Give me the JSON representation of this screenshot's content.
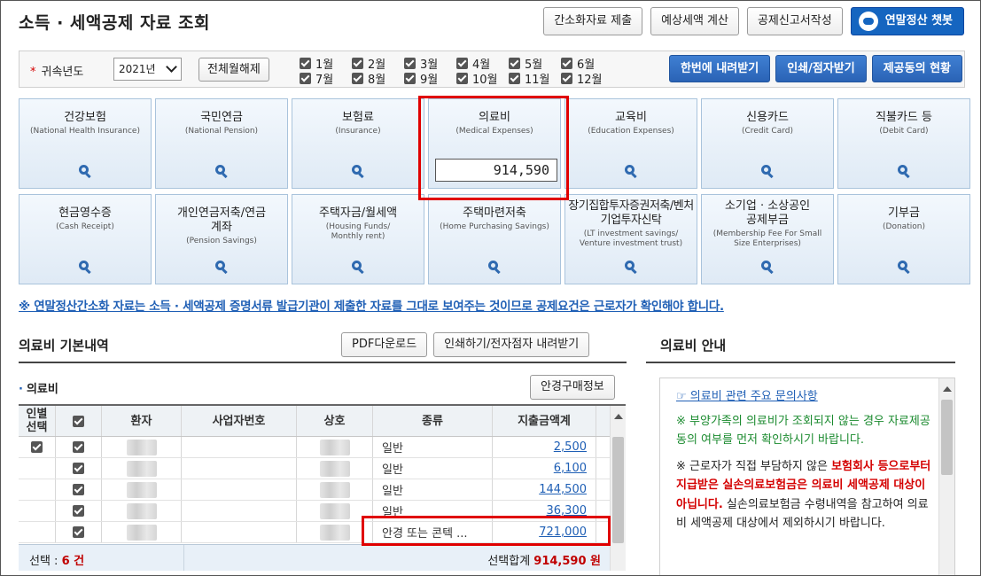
{
  "header": {
    "title": "소득 · 세액공제 자료 조회",
    "buttons": [
      "간소화자료 제출",
      "예상세액 계산",
      "공제신고서작성"
    ],
    "chatbot_label": "연말정산 챗봇"
  },
  "yearbar": {
    "label": "귀속년도",
    "year": "2021년",
    "toggle_all": "전체월해제",
    "months": [
      "1월",
      "2월",
      "3월",
      "4월",
      "5월",
      "6월",
      "7월",
      "8월",
      "9월",
      "10월",
      "11월",
      "12월"
    ],
    "actions": [
      "한번에 내려받기",
      "인쇄/점자받기",
      "제공동의 현황"
    ]
  },
  "tiles": [
    {
      "kr": "건강보험",
      "en": "(National Health Insurance)"
    },
    {
      "kr": "국민연금",
      "en": "(National Pension)"
    },
    {
      "kr": "보험료",
      "en": "(Insurance)"
    },
    {
      "kr": "의료비",
      "en": "(Medical Expenses)",
      "amount": "914,590"
    },
    {
      "kr": "교육비",
      "en": "(Education Expenses)"
    },
    {
      "kr": "신용카드",
      "en": "(Credit Card)"
    },
    {
      "kr": "직불카드 등",
      "en": "(Debit Card)"
    },
    {
      "kr": "현금영수증",
      "en": "(Cash Receipt)"
    },
    {
      "kr": "개인연금저축/연금계좌",
      "en": "(Pension Savings)"
    },
    {
      "kr": "주택자금/월세액",
      "en": "(Housing Funds/ Monthly rent)"
    },
    {
      "kr": "주택마련저축",
      "en": "(Home Purchasing Savings)"
    },
    {
      "kr": "장기집합투자증권저축/벤처기업투자신탁",
      "en": "(LT investment savings/ Venture investment trust)"
    },
    {
      "kr": "소기업 · 소상공인 공제부금",
      "en": "(Membership Fee For Small Size Enterprises)"
    },
    {
      "kr": "기부금",
      "en": "(Donation)"
    }
  ],
  "notice": "※ 연말정산간소화 자료는 소득 · 세액공제 증명서류 발급기관이 제출한 자료를 그대로 보여주는 것이므로 공제요건은 근로자가 확인해야 합니다.",
  "left": {
    "section_title": "의료비 기본내역",
    "pdf_button": "PDF다운로드",
    "print_button": "인쇄하기/전자점자 내려받기",
    "sub_title": "의료비",
    "glasses_button": "안경구매정보",
    "columns": [
      "인별선택",
      "",
      "환자",
      "사업자번호",
      "상호",
      "종류",
      "지출금액계"
    ],
    "rows": [
      {
        "type": "일반",
        "amount": "2,500"
      },
      {
        "type": "일반",
        "amount": "6,100"
      },
      {
        "type": "일반",
        "amount": "144,500"
      },
      {
        "type": "일반",
        "amount": "36,300"
      },
      {
        "type": "안경 또는 콘텍 ...",
        "amount": "721,000"
      }
    ],
    "footer_label": "선택 :",
    "footer_count": "6 건",
    "footer_sum_label": "선택합계",
    "footer_sum": "914,590 원"
  },
  "right": {
    "title": "의료비 안내",
    "link": "☞ 의료비 관련 주요 문의사항",
    "note1": "※ 부양가족의 의료비가 조회되지 않는 경우 자료제공동의 여부를 먼저 확인하시기 바랍니다.",
    "note2_pre": "※ 근로자가 직접 부담하지 않은 ",
    "note2_bold": "보험회사 등으로부터 지급받은 실손의료보험금은 의료비 세액공제 대상이 아닙니다.",
    "note2_post": " 실손의료보험금 수령내역을 참고하여 의료비 세액공제 대상에서 제외하시기 바랍니다."
  }
}
